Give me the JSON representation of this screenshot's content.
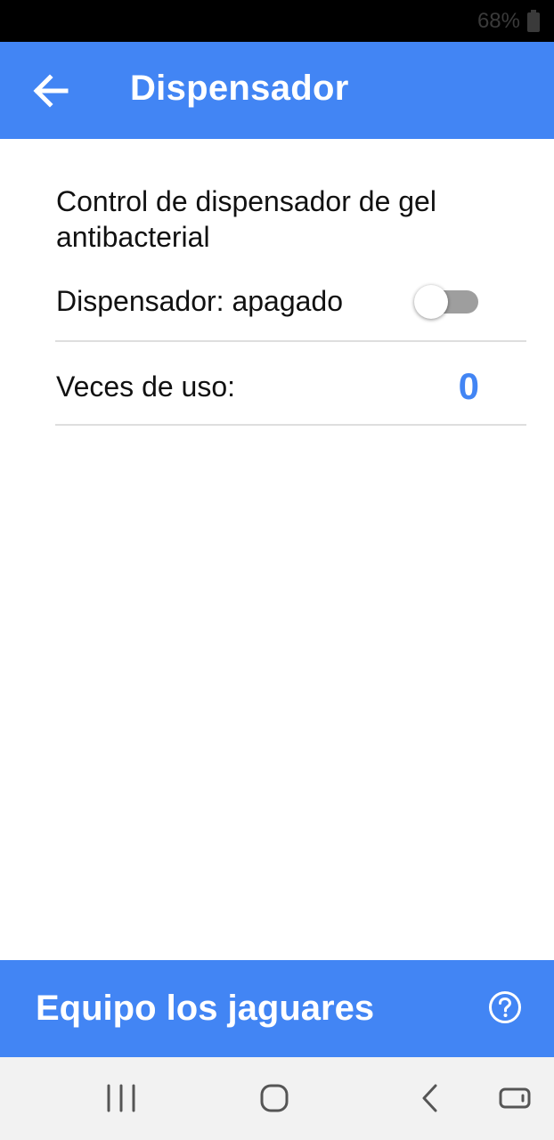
{
  "status_bar": {
    "battery_percent": "68%",
    "battery_icon": "battery-icon"
  },
  "app_bar": {
    "back_icon": "arrow-left-icon",
    "title": "Dispensador"
  },
  "content": {
    "description": "Control de dispensador de gel antibacterial",
    "dispenser": {
      "label": "Dispensador: apagado",
      "switch_on": false
    },
    "uses": {
      "label": "Veces de uso:",
      "value": "0"
    }
  },
  "footer": {
    "title": "Equipo los jaguares",
    "help_icon": "help-circle-icon"
  },
  "nav_bar": {
    "recents_icon": "recent-apps-icon",
    "home_icon": "home-icon",
    "back_icon": "back-chevron-icon",
    "rotate_icon": "rotate-screen-icon"
  },
  "colors": {
    "primary": "#4285F4",
    "text": "#111111",
    "divider": "#dedede",
    "nav_background": "#f2f2f2"
  }
}
